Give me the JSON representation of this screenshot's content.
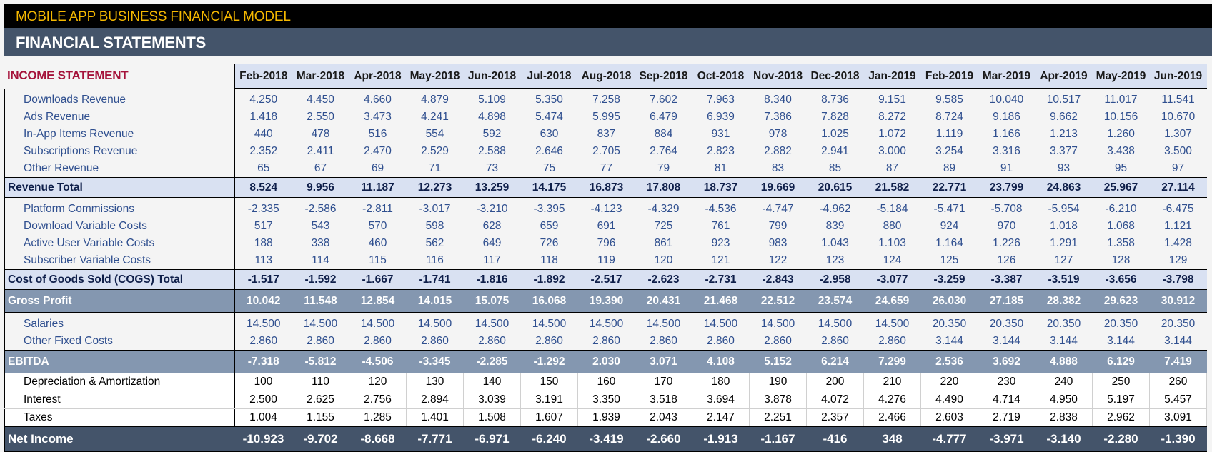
{
  "header": {
    "app_title": "MOBILE APP BUSINESS FINANCIAL MODEL",
    "page_title": "FINANCIAL STATEMENTS"
  },
  "section_title": "INCOME STATEMENT",
  "months": [
    "Feb-2018",
    "Mar-2018",
    "Apr-2018",
    "May-2018",
    "Jun-2018",
    "Jul-2018",
    "Aug-2018",
    "Sep-2018",
    "Oct-2018",
    "Nov-2018",
    "Dec-2018",
    "Jan-2019",
    "Feb-2019",
    "Mar-2019",
    "Apr-2019",
    "May-2019",
    "Jun-2019"
  ],
  "rows": [
    {
      "label": "Downloads Revenue",
      "type": "item",
      "values": [
        "4.250",
        "4.450",
        "4.660",
        "4.879",
        "5.109",
        "5.350",
        "7.258",
        "7.602",
        "7.963",
        "8.340",
        "8.736",
        "9.151",
        "9.585",
        "10.040",
        "10.517",
        "11.017",
        "11.541"
      ]
    },
    {
      "label": "Ads Revenue",
      "type": "item",
      "values": [
        "1.418",
        "2.550",
        "3.473",
        "4.241",
        "4.898",
        "5.474",
        "5.995",
        "6.479",
        "6.939",
        "7.386",
        "7.828",
        "8.272",
        "8.724",
        "9.186",
        "9.662",
        "10.156",
        "10.670"
      ]
    },
    {
      "label": "In-App Items Revenue",
      "type": "item",
      "values": [
        "440",
        "478",
        "516",
        "554",
        "592",
        "630",
        "837",
        "884",
        "931",
        "978",
        "1.025",
        "1.072",
        "1.119",
        "1.166",
        "1.213",
        "1.260",
        "1.307"
      ]
    },
    {
      "label": "Subscriptions Revenue",
      "type": "item",
      "values": [
        "2.352",
        "2.411",
        "2.470",
        "2.529",
        "2.588",
        "2.646",
        "2.705",
        "2.764",
        "2.823",
        "2.882",
        "2.941",
        "3.000",
        "3.254",
        "3.316",
        "3.377",
        "3.438",
        "3.500"
      ]
    },
    {
      "label": "Other Revenue",
      "type": "item",
      "values": [
        "65",
        "67",
        "69",
        "71",
        "73",
        "75",
        "77",
        "79",
        "81",
        "83",
        "85",
        "87",
        "89",
        "91",
        "93",
        "95",
        "97"
      ]
    },
    {
      "label": "Revenue Total",
      "type": "total",
      "values": [
        "8.524",
        "9.956",
        "11.187",
        "12.273",
        "13.259",
        "14.175",
        "16.873",
        "17.808",
        "18.737",
        "19.669",
        "20.615",
        "21.582",
        "22.771",
        "23.799",
        "24.863",
        "25.967",
        "27.114"
      ]
    },
    {
      "label": "Platform Commissions",
      "type": "item",
      "values": [
        "-2.335",
        "-2.586",
        "-2.811",
        "-3.017",
        "-3.210",
        "-3.395",
        "-4.123",
        "-4.329",
        "-4.536",
        "-4.747",
        "-4.962",
        "-5.184",
        "-5.471",
        "-5.708",
        "-5.954",
        "-6.210",
        "-6.475"
      ]
    },
    {
      "label": "Download Variable Costs",
      "type": "item",
      "values": [
        "517",
        "543",
        "570",
        "598",
        "628",
        "659",
        "691",
        "725",
        "761",
        "799",
        "839",
        "880",
        "924",
        "970",
        "1.018",
        "1.068",
        "1.121"
      ]
    },
    {
      "label": "Active User Variable Costs",
      "type": "item",
      "values": [
        "188",
        "338",
        "460",
        "562",
        "649",
        "726",
        "796",
        "861",
        "923",
        "983",
        "1.043",
        "1.103",
        "1.164",
        "1.226",
        "1.291",
        "1.358",
        "1.428"
      ]
    },
    {
      "label": "Subscriber Variable Costs",
      "type": "item",
      "values": [
        "113",
        "114",
        "115",
        "116",
        "117",
        "118",
        "119",
        "120",
        "121",
        "122",
        "123",
        "124",
        "125",
        "126",
        "127",
        "128",
        "129"
      ]
    },
    {
      "label": "Cost of Goods Sold (COGS) Total",
      "type": "total",
      "values": [
        "-1.517",
        "-1.592",
        "-1.667",
        "-1.741",
        "-1.816",
        "-1.892",
        "-2.517",
        "-2.623",
        "-2.731",
        "-2.843",
        "-2.958",
        "-3.077",
        "-3.259",
        "-3.387",
        "-3.519",
        "-3.656",
        "-3.798"
      ]
    },
    {
      "label": "Gross Profit",
      "type": "gp",
      "values": [
        "10.042",
        "11.548",
        "12.854",
        "14.015",
        "15.075",
        "16.068",
        "19.390",
        "20.431",
        "21.468",
        "22.512",
        "23.574",
        "24.659",
        "26.030",
        "27.185",
        "28.382",
        "29.623",
        "30.912"
      ]
    },
    {
      "label": "Salaries",
      "type": "item",
      "values": [
        "14.500",
        "14.500",
        "14.500",
        "14.500",
        "14.500",
        "14.500",
        "14.500",
        "14.500",
        "14.500",
        "14.500",
        "14.500",
        "14.500",
        "20.350",
        "20.350",
        "20.350",
        "20.350",
        "20.350"
      ]
    },
    {
      "label": "Other Fixed Costs",
      "type": "item",
      "values": [
        "2.860",
        "2.860",
        "2.860",
        "2.860",
        "2.860",
        "2.860",
        "2.860",
        "2.860",
        "2.860",
        "2.860",
        "2.860",
        "2.860",
        "3.144",
        "3.144",
        "3.144",
        "3.144",
        "3.144"
      ]
    },
    {
      "label": "EBITDA",
      "type": "gp",
      "values": [
        "-7.318",
        "-5.812",
        "-4.506",
        "-3.345",
        "-2.285",
        "-1.292",
        "2.030",
        "3.071",
        "4.108",
        "5.152",
        "6.214",
        "7.299",
        "2.536",
        "3.692",
        "4.888",
        "6.129",
        "7.419"
      ]
    },
    {
      "label": "Depreciation & Amortization",
      "type": "da",
      "values": [
        "100",
        "110",
        "120",
        "130",
        "140",
        "150",
        "160",
        "170",
        "180",
        "190",
        "200",
        "210",
        "220",
        "230",
        "240",
        "250",
        "260"
      ]
    },
    {
      "label": "Interest",
      "type": "da",
      "values": [
        "2.500",
        "2.625",
        "2.756",
        "2.894",
        "3.039",
        "3.191",
        "3.350",
        "3.518",
        "3.694",
        "3.878",
        "4.072",
        "4.276",
        "4.490",
        "4.714",
        "4.950",
        "5.197",
        "5.457"
      ]
    },
    {
      "label": "Taxes",
      "type": "da",
      "values": [
        "1.004",
        "1.155",
        "1.285",
        "1.401",
        "1.508",
        "1.607",
        "1.939",
        "2.043",
        "2.147",
        "2.251",
        "2.357",
        "2.466",
        "2.603",
        "2.719",
        "2.838",
        "2.962",
        "3.091"
      ]
    },
    {
      "label": "Net Income",
      "type": "net",
      "values": [
        "-10.923",
        "-9.702",
        "-8.668",
        "-7.771",
        "-6.971",
        "-6.240",
        "-3.419",
        "-2.660",
        "-1.913",
        "-1.167",
        "-416",
        "348",
        "-4.777",
        "-3.971",
        "-3.140",
        "-2.280",
        "-1.390"
      ]
    }
  ]
}
